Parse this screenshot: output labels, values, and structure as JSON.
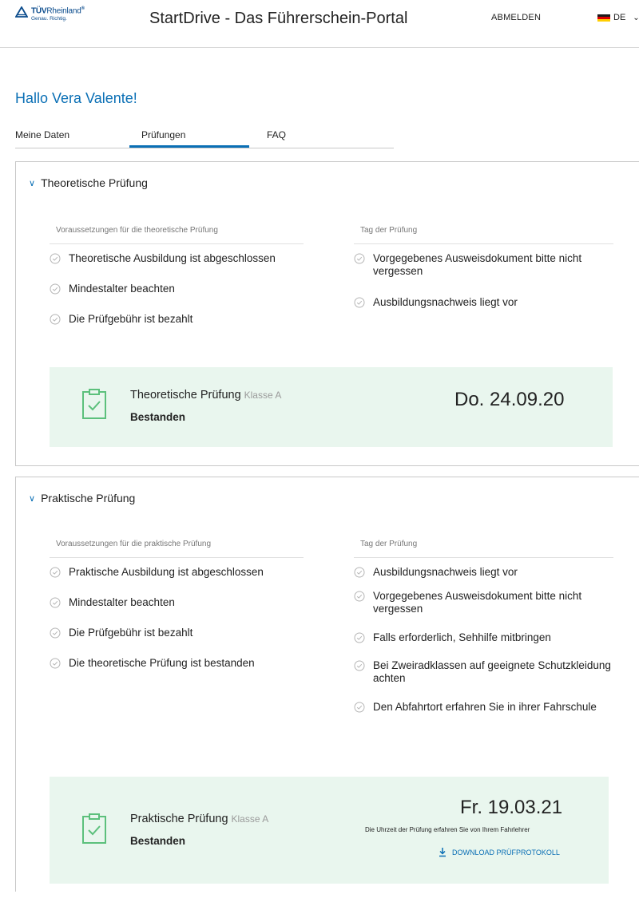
{
  "header": {
    "logo_brand_bold": "TÜV",
    "logo_brand_thin": "Rheinland",
    "logo_registered": "®",
    "logo_tagline": "Genau. Richtig.",
    "portal_title": "StartDrive - Das Führerschein-Portal",
    "logout_label": "ABMELDEN",
    "language_code": "DE"
  },
  "colors": {
    "accent": "#0a6fb5",
    "card_bg": "#e9f6ee",
    "card_icon": "#5cc07c",
    "check": "#b5b5b5"
  },
  "greeting": "Hallo Vera Valente!",
  "tabs": {
    "items": [
      {
        "label": "Meine Daten"
      },
      {
        "label": "Prüfungen"
      },
      {
        "label": "FAQ"
      }
    ],
    "active": "Prüfungen"
  },
  "theory": {
    "title": "Theoretische Prüfung",
    "requirements_heading": "Voraussetzungen für die theoretische Prüfung",
    "requirements": [
      "Theoretische Ausbildung ist abgeschlossen",
      "Mindestalter beachten",
      "Die Prüfgebühr ist bezahlt"
    ],
    "exam_day_heading": "Tag der Prüfung",
    "exam_day": [
      "Vorgegebenes Ausweisdokument bitte nicht vergessen",
      "Ausbildungsnachweis liegt vor"
    ],
    "card": {
      "title": "Theoretische Prüfung",
      "class": "Klasse A",
      "status": "Bestanden",
      "date": "Do. 24.09.20"
    }
  },
  "practical": {
    "title": "Praktische Prüfung",
    "requirements_heading": "Voraussetzungen für die praktische Prüfung",
    "requirements": [
      "Praktische Ausbildung ist abgeschlossen",
      "Mindestalter beachten",
      "Die Prüfgebühr ist bezahlt",
      "Die theoretische Prüfung ist bestanden"
    ],
    "exam_day_heading": "Tag der Prüfung",
    "exam_day": [
      "Ausbildungsnachweis liegt vor",
      "Vorgegebenes Ausweisdokument bitte nicht vergessen",
      "Falls erforderlich, Sehhilfe mitbringen",
      "Bei Zweiradklassen auf geeignete Schutzkleidung achten",
      "Den Abfahrtort erfahren Sie in ihrer Fahrschule"
    ],
    "card": {
      "title": "Praktische Prüfung",
      "class": "Klasse A",
      "status": "Bestanden",
      "date": "Fr. 19.03.21",
      "note": "Die Uhrzeit der Prüfung erfahren Sie von Ihrem Fahrlehrer",
      "download_label": "DOWNLOAD PRÜFPROTOKOLL"
    }
  }
}
